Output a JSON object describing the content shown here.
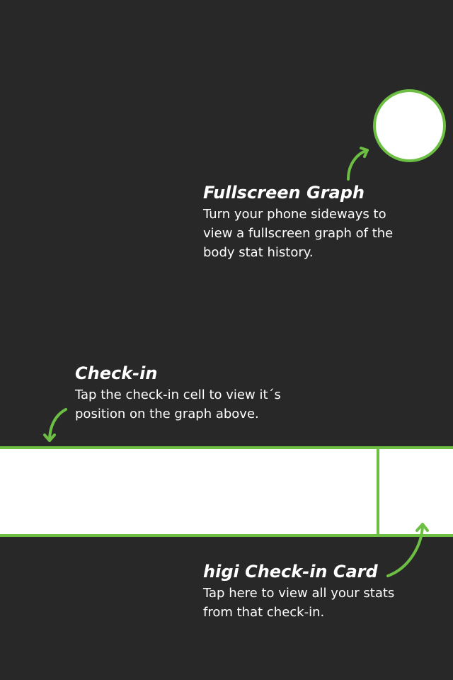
{
  "colors": {
    "background": "#282828",
    "accent": "#6cbf43",
    "highlight": "#ffffff",
    "text": "#ffffff"
  },
  "tips": {
    "fullscreen_graph": {
      "title": "Fullscreen Graph",
      "body": "Turn your phone sideways to view a fullscreen graph of the body stat history."
    },
    "check_in": {
      "title": "Check-in",
      "body": "Tap the check-in cell to view it´s position on the graph above."
    },
    "card": {
      "title": "higi Check-in Card",
      "body": "Tap here to view all your stats from that check-in."
    }
  },
  "icons": {
    "arrow": "curved-arrow-icon"
  }
}
